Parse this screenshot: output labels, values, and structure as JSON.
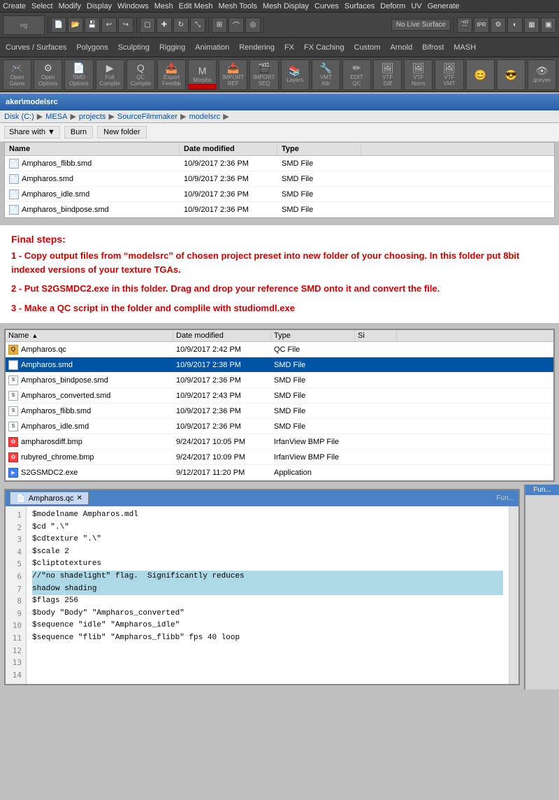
{
  "maya": {
    "menu_items": [
      "Create",
      "Select",
      "Modify",
      "Display",
      "Windows",
      "Mesh",
      "Edit Mesh",
      "Mesh Tools",
      "Mesh Display",
      "Curves",
      "Surfaces",
      "Deform",
      "UV",
      "Generate"
    ],
    "toolbar": {
      "no_live_surface": "No Live Surface",
      "mesh_display": "Mesh Display"
    },
    "shelf_buttons": [
      {
        "label": "Open\nGame",
        "icon": "🎮"
      },
      {
        "label": "Open\nOptions",
        "icon": "⚙"
      },
      {
        "label": "SMD\nOptions",
        "icon": "📄"
      },
      {
        "label": "Full\nCompile",
        "icon": "▶"
      },
      {
        "label": "QC\nCompile",
        "icon": "Q"
      },
      {
        "label": "Export\nFeedback",
        "icon": "📤"
      },
      {
        "label": "IMPORT\nREFERENCE",
        "icon": "📥"
      },
      {
        "label": "IMPORT\nSEQUENCE",
        "icon": "🎬"
      },
      {
        "label": "Layers\nEditor",
        "icon": "📚"
      },
      {
        "label": "VMT\nAttributes",
        "icon": "🔧"
      },
      {
        "label": "EDIT\nQC",
        "icon": "✏"
      },
      {
        "label": "VTF Edit\nDiffuse",
        "icon": "🖼"
      },
      {
        "label": "VTF Edit\nNormal",
        "icon": "🖼"
      },
      {
        "label": "VTF Edit\nVMT",
        "icon": "🖼"
      }
    ],
    "morphs_label": "Morphs"
  },
  "explorer1": {
    "title": "aker\\modelsrc",
    "address": {
      "disk": "Disk (C:)",
      "segments": [
        "MESA",
        "projects",
        "SourceFilmmaker",
        "modelsrc"
      ]
    },
    "toolbar": {
      "share_with": "Share with",
      "burn": "Burn",
      "new_folder": "New folder"
    },
    "columns": [
      "Name",
      "Date modified",
      "Type"
    ],
    "files": [
      {
        "name": "Ampharos_flibb.smd",
        "date": "10/9/2017 2:36 PM",
        "type": "SMD File"
      },
      {
        "name": "Ampharos.smd",
        "date": "10/9/2017 2:36 PM",
        "type": "SMD File"
      },
      {
        "name": "Ampharos_idle.smd",
        "date": "10/9/2017 2:36 PM",
        "type": "SMD File"
      },
      {
        "name": "Ampharos_bindpose.smd",
        "date": "10/9/2017 2:36 PM",
        "type": "SMD File"
      }
    ]
  },
  "instructions": {
    "title": "Final steps:",
    "step1": "1 - Copy output files from “modelsrc” of chosen project preset into new folder of your choosing.  In this folder put 8bit indexed versions of your texture TGAs.",
    "step2": "2 - Put S2GSMDC2.exe in this folder. Drag and drop your reference SMD onto it and convert the file.",
    "step3": "3 - Make a QC script in the folder and complile with studiomdl.exe"
  },
  "explorer2": {
    "columns": [
      "Name",
      "Date modified",
      "Type",
      "Si"
    ],
    "files": [
      {
        "name": "Ampharos.qc",
        "date": "10/9/2017 2:42 PM",
        "type": "QC File",
        "icon": "qc"
      },
      {
        "name": "Ampharos.smd",
        "date": "10/9/2017 2:38 PM",
        "type": "SMD File",
        "icon": "smd",
        "selected": true
      },
      {
        "name": "Ampharos_bindpose.smd",
        "date": "10/9/2017 2:36 PM",
        "type": "SMD File",
        "icon": "smd"
      },
      {
        "name": "Ampharos_converted.smd",
        "date": "10/9/2017 2:43 PM",
        "type": "SMD File",
        "icon": "smd"
      },
      {
        "name": "Ampharos_flibb.smd",
        "date": "10/9/2017 2:36 PM",
        "type": "SMD File",
        "icon": "smd"
      },
      {
        "name": "Ampharos_idle.smd",
        "date": "10/9/2017 2:36 PM",
        "type": "SMD File",
        "icon": "smd"
      },
      {
        "name": "ampharosdiff.bmp",
        "date": "9/24/2017 10:05 PM",
        "type": "IrfanView BMP File",
        "icon": "bmp"
      },
      {
        "name": "rubyred_chrome.bmp",
        "date": "9/24/2017 10:09 PM",
        "type": "IrfanView BMP File",
        "icon": "bmp"
      },
      {
        "name": "S2GSMDC2.exe",
        "date": "9/12/2017 11:20 PM",
        "type": "Application",
        "icon": "exe"
      }
    ]
  },
  "code_editor": {
    "title": "Fun...",
    "tab": "Ampharos.qc",
    "lines": [
      {
        "num": 1,
        "code": "$modelname Ampharos.mdl"
      },
      {
        "num": 2,
        "code": "$cd \".\\\""
      },
      {
        "num": 3,
        "code": "$cdtexture \".\\\""
      },
      {
        "num": 4,
        "code": "$scale 2"
      },
      {
        "num": 5,
        "code": "$cliptotextures"
      },
      {
        "num": 6,
        "code": ""
      },
      {
        "num": 7,
        "code": "//\"no shadelight\" flag.  Significantly reduces\nshadow shading",
        "highlight": true
      },
      {
        "num": 8,
        "code": "$flags 256"
      },
      {
        "num": 9,
        "code": ""
      },
      {
        "num": 10,
        "code": "$body \"Body\" \"Ampharos_converted\""
      },
      {
        "num": 11,
        "code": ""
      },
      {
        "num": 12,
        "code": "$sequence \"idle\" \"Ampharos_idle\""
      },
      {
        "num": 13,
        "code": ""
      },
      {
        "num": 14,
        "code": "$sequence \"flib\" \"Ampharos_flibb\" fps 40 loop"
      }
    ]
  }
}
